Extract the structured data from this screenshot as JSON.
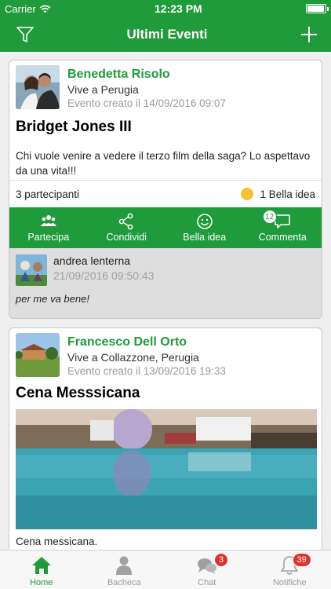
{
  "status_bar": {
    "carrier": "Carrier",
    "time": "12:23 PM"
  },
  "header": {
    "title": "Ultimi Eventi",
    "left_icon": "filter-icon",
    "right_icon": "plus-icon"
  },
  "events": [
    {
      "user": "Benedetta Risolo",
      "place": "Vive a Perugia",
      "created": "Evento creato il 14/09/2016 09:07",
      "title": "Bridget Jones III",
      "description": "Chi vuole venire a vedere il terzo film della saga? Lo aspettavo da una vita!!!",
      "participants": "3  partecipanti",
      "reactions": "1  Bella idea",
      "actions": [
        "Partecipa",
        "Condividi",
        "Bella idea",
        "Commenta"
      ],
      "comment_count": "12",
      "comment": {
        "author": "andrea lenterna",
        "time": "21/09/2016 09:50:43",
        "text": "per me va bene!"
      }
    },
    {
      "user": "Francesco Dell Orto",
      "place": "Vive a Collazzone, Perugia",
      "created": "Evento creato il 13/09/2016 19:33",
      "title": "Cena Messsicana",
      "caption": "Cena messicana."
    }
  ],
  "tabbar": [
    {
      "label": "Home",
      "icon": "home-icon",
      "active": true
    },
    {
      "label": "Bacheca",
      "icon": "person-icon"
    },
    {
      "label": "Chat",
      "icon": "chat-bubbles-icon",
      "badge": "3"
    },
    {
      "label": "Notifiche",
      "icon": "bell-icon",
      "badge": "39"
    }
  ],
  "colors": {
    "primary": "#1f9b3b",
    "badge": "#e0332e",
    "background": "#efefef"
  }
}
